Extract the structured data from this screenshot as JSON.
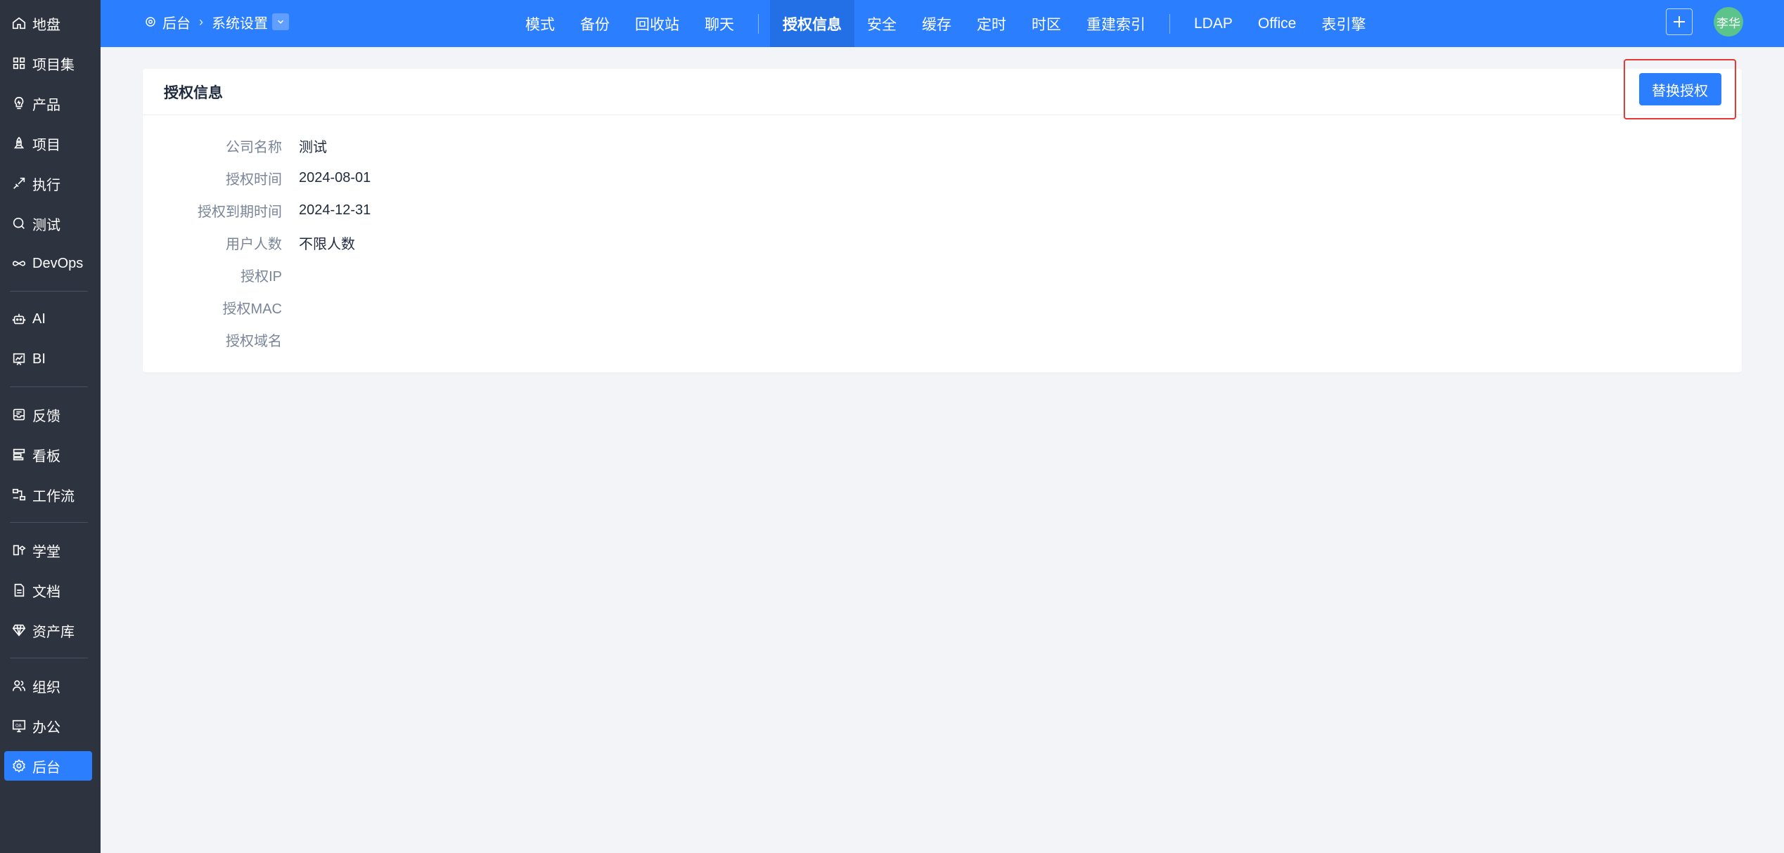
{
  "sidebar": {
    "items": [
      {
        "key": "home",
        "label": "地盘",
        "icon": "home-icon"
      },
      {
        "key": "program",
        "label": "项目集",
        "icon": "grid-icon"
      },
      {
        "key": "product",
        "label": "产品",
        "icon": "bulb-icon"
      },
      {
        "key": "project",
        "label": "项目",
        "icon": "rocket-icon"
      },
      {
        "key": "execution",
        "label": "执行",
        "icon": "run-icon"
      },
      {
        "key": "qa",
        "label": "测试",
        "icon": "magnifier-icon"
      },
      {
        "key": "devops",
        "label": "DevOps",
        "icon": "infinity-icon"
      },
      {
        "key": "ai",
        "label": "AI",
        "icon": "robot-icon"
      },
      {
        "key": "bi",
        "label": "BI",
        "icon": "chart-icon"
      },
      {
        "key": "feedback",
        "label": "反馈",
        "icon": "inbox-icon"
      },
      {
        "key": "kanban",
        "label": "看板",
        "icon": "kanban-icon"
      },
      {
        "key": "workflow",
        "label": "工作流",
        "icon": "flow-icon"
      },
      {
        "key": "academy",
        "label": "学堂",
        "icon": "academy-icon"
      },
      {
        "key": "doc",
        "label": "文档",
        "icon": "document-icon"
      },
      {
        "key": "assetlib",
        "label": "资产库",
        "icon": "diamond-icon"
      },
      {
        "key": "org",
        "label": "组织",
        "icon": "people-icon"
      },
      {
        "key": "oa",
        "label": "办公",
        "icon": "oa-icon"
      },
      {
        "key": "admin",
        "label": "后台",
        "icon": "gear-icon"
      }
    ]
  },
  "breadcrumb": {
    "root": "后台",
    "current": "系统设置"
  },
  "tabs": [
    {
      "label": "模式"
    },
    {
      "label": "备份"
    },
    {
      "label": "回收站"
    },
    {
      "label": "聊天"
    },
    {
      "label": "授权信息"
    },
    {
      "label": "安全"
    },
    {
      "label": "缓存"
    },
    {
      "label": "定时"
    },
    {
      "label": "时区"
    },
    {
      "label": "重建索引"
    },
    {
      "label": "LDAP"
    },
    {
      "label": "Office"
    },
    {
      "label": "表引擎"
    }
  ],
  "user": {
    "avatar_text": "李华"
  },
  "panel": {
    "title": "授权信息",
    "replace_button": "替换授权",
    "rows": [
      {
        "label": "公司名称",
        "value": "测试"
      },
      {
        "label": "授权时间",
        "value": "2024-08-01"
      },
      {
        "label": "授权到期时间",
        "value": "2024-12-31"
      },
      {
        "label": "用户人数",
        "value": "不限人数"
      },
      {
        "label": "授权IP",
        "value": ""
      },
      {
        "label": "授权MAC",
        "value": ""
      },
      {
        "label": "授权域名",
        "value": ""
      }
    ]
  },
  "colors": {
    "sidebar_bg": "#2e3340",
    "primary": "#2b7fff",
    "highlight_border": "#e53935",
    "avatar_bg": "#5cc38a"
  }
}
